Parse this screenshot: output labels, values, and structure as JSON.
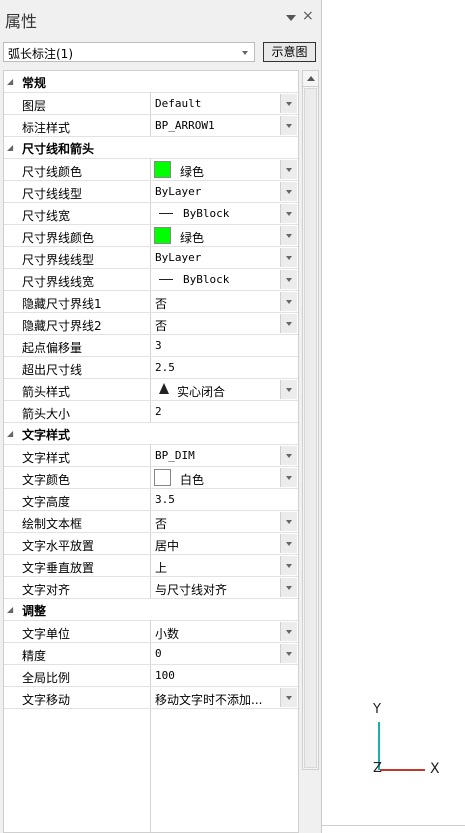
{
  "panel": {
    "title": "属性",
    "close_label": "×",
    "selector_value": "弧长标注(1)",
    "preview_button_label": "示意图"
  },
  "colors": {
    "green": "#00ff00",
    "white": "#ffffff",
    "axis_x": "#c0392b",
    "axis_y": "#1ab0b0"
  },
  "categories": {
    "general": "常规",
    "dimline": "尺寸线和箭头",
    "text": "文字样式",
    "adjust": "调整"
  },
  "props": {
    "layer": {
      "name": "图层",
      "value": "Default"
    },
    "dimstyle": {
      "name": "标注样式",
      "value": "BP_ARROW1"
    },
    "dim_color": {
      "name": "尺寸线颜色",
      "value": "绿色"
    },
    "dim_linetype": {
      "name": "尺寸线线型",
      "value": "ByLayer"
    },
    "dim_lineweight": {
      "name": "尺寸线宽",
      "value": "ByBlock"
    },
    "ext_color": {
      "name": "尺寸界线颜色",
      "value": "绿色"
    },
    "ext_linetype": {
      "name": "尺寸界线线型",
      "value": "ByLayer"
    },
    "ext_lineweight": {
      "name": "尺寸界线线宽",
      "value": "ByBlock"
    },
    "hide_ext1": {
      "name": "隐藏尺寸界线1",
      "value": "否"
    },
    "hide_ext2": {
      "name": "隐藏尺寸界线2",
      "value": "否"
    },
    "origin_offset": {
      "name": "起点偏移量",
      "value": "3"
    },
    "ext_beyond": {
      "name": "超出尺寸线",
      "value": "2.5"
    },
    "arrow_style": {
      "name": "箭头样式",
      "value": "实心闭合"
    },
    "arrow_size": {
      "name": "箭头大小",
      "value": "2"
    },
    "text_style": {
      "name": "文字样式",
      "value": "BP_DIM"
    },
    "text_color": {
      "name": "文字颜色",
      "value": "白色"
    },
    "text_height": {
      "name": "文字高度",
      "value": "3.5"
    },
    "text_frame": {
      "name": "绘制文本框",
      "value": "否"
    },
    "text_hpos": {
      "name": "文字水平放置",
      "value": "居中"
    },
    "text_vpos": {
      "name": "文字垂直放置",
      "value": "上"
    },
    "text_align": {
      "name": "文字对齐",
      "value": "与尺寸线对齐"
    },
    "text_unit": {
      "name": "文字单位",
      "value": "小数"
    },
    "precision": {
      "name": "精度",
      "value": "0"
    },
    "global_scale": {
      "name": "全局比例",
      "value": "100"
    },
    "text_move": {
      "name": "文字移动",
      "value": "移动文字时不添加..."
    }
  },
  "canvas": {
    "axis_y": "Y",
    "axis_x": "X",
    "axis_z": "Z"
  }
}
